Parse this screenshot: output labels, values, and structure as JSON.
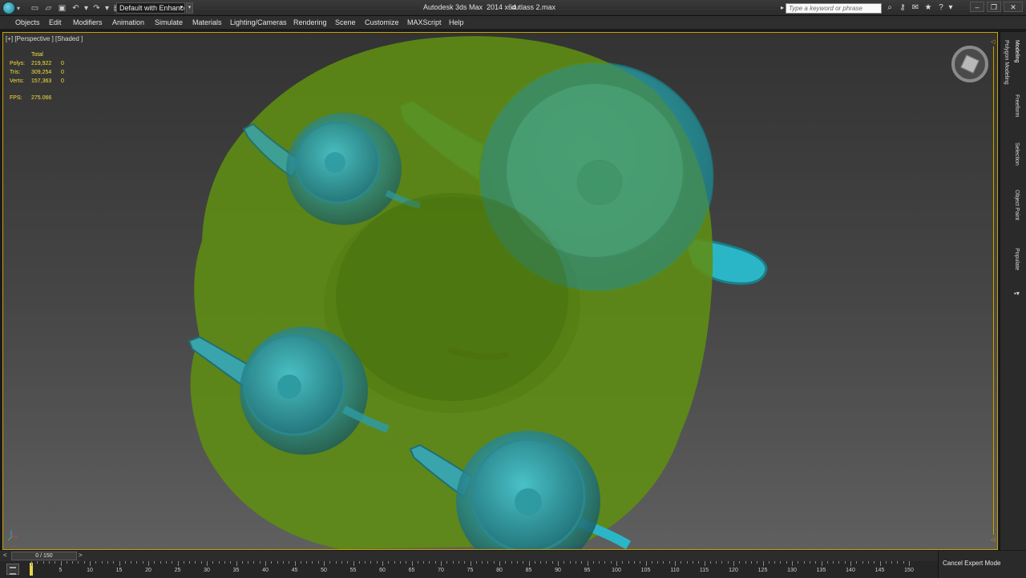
{
  "titlebar": {
    "workspace": "Default with Enhance",
    "app_title": "Autodesk 3ds Max  2014 x64",
    "file_name": "cutlass 2.max",
    "search_placeholder": "Type a keyword or phrase"
  },
  "menu": [
    "Objects",
    "Edit",
    "Modifiers",
    "Animation",
    "Simulate",
    "Materials",
    "Lighting/Cameras",
    "Rendering",
    "Scene",
    "Customize",
    "MAXScript",
    "Help"
  ],
  "viewport": {
    "label": "[+] [Perspective ] [Shaded ]",
    "stats": {
      "header": "Total",
      "rows": [
        {
          "key": "Polys:",
          "total": "219,922",
          "sel": "0"
        },
        {
          "key": "Tris:",
          "total": "309,254",
          "sel": "0"
        },
        {
          "key": "Verts:",
          "total": "157,363",
          "sel": "0"
        }
      ],
      "fps_key": "FPS:",
      "fps_value": "275.066"
    }
  },
  "ribbon_tabs": [
    "Modeling",
    "Polygon Modeling",
    "Freeform",
    "Selection",
    "Object Paint",
    "Populate"
  ],
  "timeslider": {
    "left_arrow": "<",
    "position": "0 / 150",
    "right_arrow": ">"
  },
  "trackbar": {
    "ticks": [
      "5",
      "10",
      "15",
      "20",
      "25",
      "30",
      "35",
      "40",
      "45",
      "50",
      "55",
      "60",
      "65",
      "70",
      "75",
      "80",
      "85",
      "90",
      "95",
      "100",
      "105",
      "110",
      "115",
      "120",
      "125",
      "130",
      "135",
      "140",
      "145",
      "150"
    ]
  },
  "status": {
    "expert_mode": "Cancel Expert Mode"
  },
  "colors": {
    "selection_border": "#c8a000",
    "stat_text": "#f2e03a",
    "boolean_volume": "#5a7a14",
    "teapot": "#2fa0a8"
  }
}
